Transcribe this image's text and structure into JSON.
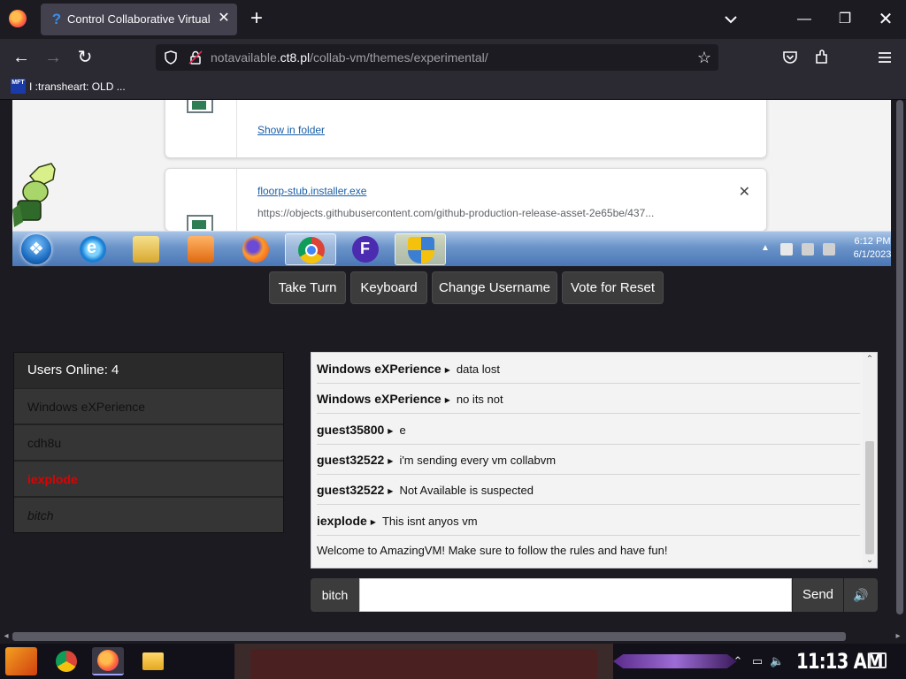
{
  "browser": {
    "tab_title": "Control Collaborative Virtual M",
    "tab_icon": "question-icon",
    "url_prefix": "notavailable.",
    "url_host": "ct8.pl",
    "url_path": "/collab-vm/themes/experimental/",
    "bookmark_icon_text": "MFT",
    "bookmark_label": "I :transheart: OLD ..."
  },
  "vm_screen": {
    "downloads": {
      "show_in_folder": "Show in folder",
      "file_name": "floorp-stub.installer.exe",
      "file_url": "https://objects.githubusercontent.com/github-production-release-asset-2e65be/437..."
    },
    "taskbar": {
      "apps": [
        "start-orb",
        "internet-explorer-icon",
        "explorer-icon",
        "media-player-icon",
        "firefox-icon",
        "chrome-icon",
        "floorp-icon",
        "security-shield-icon"
      ],
      "clock_time": "6:12 PM",
      "clock_date": "6/1/2023"
    }
  },
  "controls": {
    "take_turn": "Take Turn",
    "keyboard": "Keyboard",
    "change_username": "Change Username",
    "vote_reset": "Vote for Reset"
  },
  "users": {
    "header": "Users Online: 4",
    "list": [
      {
        "name": "Windows eXPerience",
        "style": "normal"
      },
      {
        "name": "cdh8u",
        "style": "normal"
      },
      {
        "name": "iexplode",
        "style": "red"
      },
      {
        "name": "bitch",
        "style": "italic"
      }
    ]
  },
  "chat": {
    "messages": [
      {
        "user": "Windows eXPerience",
        "text": "data lost"
      },
      {
        "user": "Windows eXPerience",
        "text": "no its not"
      },
      {
        "user": "guest35800",
        "text": "e"
      },
      {
        "user": "guest32522",
        "text": "i'm sending every vm collabvm"
      },
      {
        "user": "guest32522",
        "text": "Not Available is suspected"
      },
      {
        "user": "iexplode",
        "text": "This isnt anyos vm"
      }
    ],
    "system_message": "Welcome to AmazingVM! Make sure to follow the rules and have fun!",
    "username": "bitch",
    "input_value": "",
    "send_label": "Send"
  },
  "host_taskbar": {
    "clock": "11:13 AM"
  },
  "colors": {
    "browser_bg": "#1c1b22",
    "toolbar_bg": "#2b2a33",
    "accent_red_user": "#e00000",
    "link_blue": "#1a5fa8"
  }
}
